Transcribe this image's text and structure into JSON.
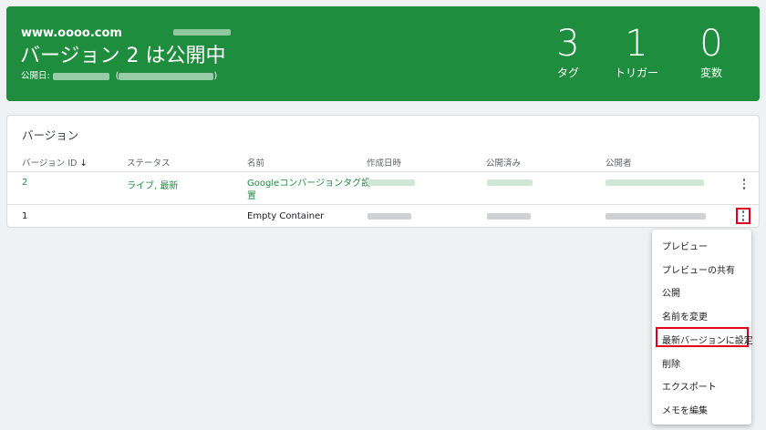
{
  "banner": {
    "site": "www.oooo.com",
    "title": "バージョン 2 は公開中",
    "pubdate_label": "公開日:",
    "pubdate_open": "(",
    "pubdate_close": ")",
    "stats": [
      {
        "num": "3",
        "label": "タグ"
      },
      {
        "num": "1",
        "label": "トリガー"
      },
      {
        "num": "0",
        "label": "変数"
      }
    ],
    "bg_color": "#1e8e3e"
  },
  "versions": {
    "title": "バージョン",
    "columns": [
      "バージョン ID",
      "ステータス",
      "名前",
      "作成日時",
      "公開済み",
      "公開者"
    ],
    "sort_icon": "arrow-down-icon",
    "rows": [
      {
        "id": "2",
        "status": "ライブ, 最新",
        "name_line1": "Googleコンバージョンタグ設",
        "name_line2": "置"
      },
      {
        "id": "1",
        "status": "",
        "name_line1": "Empty Container",
        "name_line2": ""
      }
    ]
  },
  "menu": {
    "items": [
      "プレビュー",
      "プレビューの共有",
      "公開",
      "名前を変更",
      "最新バージョンに設定",
      "削除",
      "エクスポート",
      "メモを編集"
    ],
    "highlight_color": "#e0001b"
  }
}
